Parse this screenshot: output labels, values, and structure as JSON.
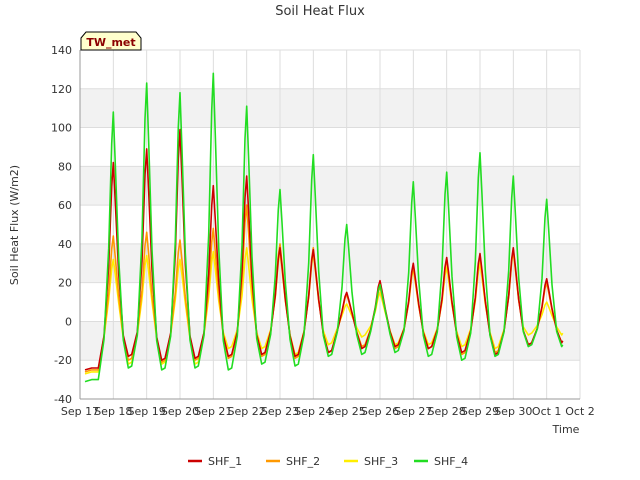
{
  "chart_data": {
    "type": "line",
    "title": "Soil Heat Flux",
    "ylabel": "Soil Heat Flux (W/m2)",
    "xlabel": "Time",
    "ylim": [
      -40,
      140
    ],
    "xlim": [
      0,
      15
    ],
    "yticks": [
      -40,
      -20,
      0,
      20,
      40,
      60,
      80,
      100,
      120,
      140
    ],
    "xticks": [
      0,
      1,
      2,
      3,
      4,
      5,
      6,
      7,
      8,
      9,
      10,
      11,
      12,
      13,
      14,
      15
    ],
    "xtick_labels": [
      "Sep 17",
      "Sep 18",
      "Sep 19",
      "Sep 20",
      "Sep 21",
      "Sep 22",
      "Sep 23",
      "Sep 24",
      "Sep 25",
      "Sep 26",
      "Sep 27",
      "Sep 28",
      "Sep 29",
      "Sep 30",
      "Oct 1",
      "Oct 2"
    ],
    "grid": true,
    "band_colors": [
      "#ffffff",
      "#f2f2f2"
    ],
    "legend_position": "bottom",
    "annotation": "TW_met",
    "days": [
      {
        "x": 1,
        "peaks": [
          82,
          44,
          32,
          108
        ],
        "nights": [
          -18,
          -20,
          -22,
          -24
        ]
      },
      {
        "x": 2,
        "peaks": [
          89,
          46,
          34,
          123
        ],
        "nights": [
          -20,
          -21,
          -22,
          -25
        ]
      },
      {
        "x": 3,
        "peaks": [
          99,
          42,
          32,
          118
        ],
        "nights": [
          -19,
          -20,
          -22,
          -24
        ]
      },
      {
        "x": 4,
        "peaks": [
          70,
          48,
          36,
          128
        ],
        "nights": [
          -18,
          -19,
          -14,
          -25
        ]
      },
      {
        "x": 5,
        "peaks": [
          75,
          60,
          38,
          111
        ],
        "nights": [
          -17,
          -18,
          -14,
          -22
        ]
      },
      {
        "x": 6,
        "peaks": [
          38,
          40,
          36,
          68
        ],
        "nights": [
          -18,
          -19,
          -17,
          -23
        ]
      },
      {
        "x": 7,
        "peaks": [
          37,
          38,
          35,
          86
        ],
        "nights": [
          -16,
          -16,
          -12,
          -18
        ]
      },
      {
        "x": 8,
        "peaks": [
          15,
          14,
          9,
          50
        ],
        "nights": [
          -14,
          -13,
          -8,
          -17
        ]
      },
      {
        "x": 9,
        "peaks": [
          21,
          18,
          15,
          19
        ],
        "nights": [
          -13,
          -14,
          -12,
          -16
        ]
      },
      {
        "x": 10,
        "peaks": [
          30,
          28,
          27,
          72
        ],
        "nights": [
          -14,
          -14,
          -12,
          -18
        ]
      },
      {
        "x": 11,
        "peaks": [
          33,
          32,
          28,
          77
        ],
        "nights": [
          -16,
          -17,
          -13,
          -20
        ]
      },
      {
        "x": 12,
        "peaks": [
          35,
          34,
          30,
          87
        ],
        "nights": [
          -17,
          -16,
          -14,
          -18
        ]
      },
      {
        "x": 13,
        "peaks": [
          38,
          37,
          36,
          75
        ],
        "nights": [
          -12,
          -12,
          -7,
          -13
        ]
      },
      {
        "x": 14,
        "peaks": [
          22,
          20,
          10,
          63
        ],
        "nights": [
          -11,
          -11,
          -7,
          -13
        ]
      }
    ],
    "series": [
      {
        "name": "SHF_1",
        "color": "#cc0000",
        "start": -25
      },
      {
        "name": "SHF_2",
        "color": "#ff9900",
        "start": -26
      },
      {
        "name": "SHF_3",
        "color": "#ffee00",
        "start": -27
      },
      {
        "name": "SHF_4",
        "color": "#22dd22",
        "start": -31
      }
    ]
  }
}
